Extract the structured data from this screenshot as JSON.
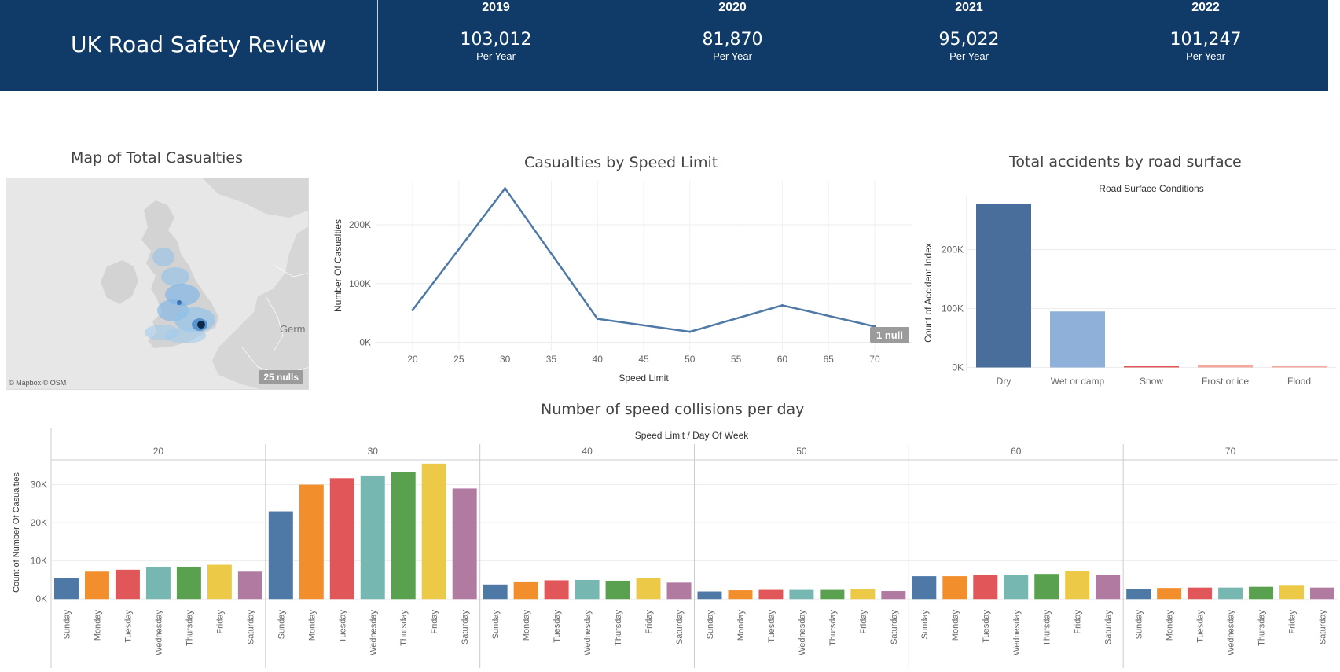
{
  "header": {
    "title": "UK Road Safety Review",
    "kpis": [
      {
        "year": "2019",
        "value": "103,012",
        "sub": "Per Year"
      },
      {
        "year": "2020",
        "value": "81,870",
        "sub": "Per Year"
      },
      {
        "year": "2021",
        "value": "95,022",
        "sub": "Per Year"
      },
      {
        "year": "2022",
        "value": "101,247",
        "sub": "Per Year"
      }
    ]
  },
  "map": {
    "title": "Map of Total Casualties",
    "attribution": "© Mapbox © OSM",
    "nulls_label": "25 nulls",
    "country_label": "Germ"
  },
  "colors": {
    "header_bg": "#103a68",
    "line": "#4e79a7",
    "dry": "#4a6e9c",
    "wet": "#8fb1d9",
    "snow": "#e15759",
    "frost": "#f4a79d",
    "days": [
      "#4e79a7",
      "#f28e2b",
      "#e15759",
      "#76b7b2",
      "#59a14f",
      "#edc948",
      "#b07aa1"
    ]
  },
  "chart_data": [
    {
      "type": "line",
      "title": "Casualties by Speed Limit",
      "xlabel": "Speed Limit",
      "ylabel": "Number Of Casualties",
      "x": [
        20,
        30,
        40,
        50,
        60,
        70
      ],
      "values": [
        55000,
        262000,
        40000,
        18000,
        63000,
        27000
      ],
      "x_ticks": [
        20,
        25,
        30,
        35,
        40,
        45,
        50,
        55,
        60,
        65,
        70
      ],
      "xlim": [
        16,
        74
      ],
      "y_ticks": [
        0,
        100000,
        200000
      ],
      "y_tick_labels": [
        "0K",
        "100K",
        "200K"
      ],
      "ylim": [
        -14000,
        275000
      ],
      "null_label": "1 null",
      "grid": true
    },
    {
      "type": "bar",
      "title": "Total accidents by road surface",
      "subtitle": "Road Surface Conditions",
      "ylabel": "Count of Accident Index",
      "categories": [
        "Dry",
        "Wet or damp",
        "Snow",
        "Frost or ice",
        "Flood"
      ],
      "values": [
        278000,
        95000,
        1500,
        4500,
        500
      ],
      "y_ticks": [
        0,
        100000,
        200000
      ],
      "y_tick_labels": [
        "0K",
        "100K",
        "200K"
      ],
      "ylim": [
        -10000,
        290000
      ],
      "grid": true
    },
    {
      "type": "bar",
      "title": "Number of speed collisions per day",
      "header": "Speed Limit  /  Day Of Week",
      "ylabel": "Count of Number Of Casualties",
      "groups": [
        "20",
        "30",
        "40",
        "50",
        "60",
        "70"
      ],
      "categories": [
        "Sunday",
        "Monday",
        "Tuesday",
        "Wednesday",
        "Thursday",
        "Friday",
        "Saturday"
      ],
      "series": [
        {
          "group": "20",
          "values": [
            5500,
            7200,
            7700,
            8300,
            8500,
            9000,
            7200
          ]
        },
        {
          "group": "30",
          "values": [
            23000,
            30000,
            31700,
            32400,
            33300,
            35500,
            29000
          ]
        },
        {
          "group": "40",
          "values": [
            3800,
            4600,
            4900,
            5000,
            4800,
            5400,
            4300
          ]
        },
        {
          "group": "50",
          "values": [
            2000,
            2300,
            2400,
            2400,
            2400,
            2600,
            2100
          ]
        },
        {
          "group": "60",
          "values": [
            6000,
            6000,
            6400,
            6400,
            6600,
            7300,
            6400
          ]
        },
        {
          "group": "70",
          "values": [
            2600,
            2900,
            3000,
            3000,
            3200,
            3700,
            3000
          ]
        }
      ],
      "y_ticks": [
        0,
        10000,
        20000,
        30000
      ],
      "y_tick_labels": [
        "0K",
        "10K",
        "20K",
        "30K"
      ],
      "ylim": [
        -1600,
        36500
      ],
      "grid": true
    }
  ]
}
